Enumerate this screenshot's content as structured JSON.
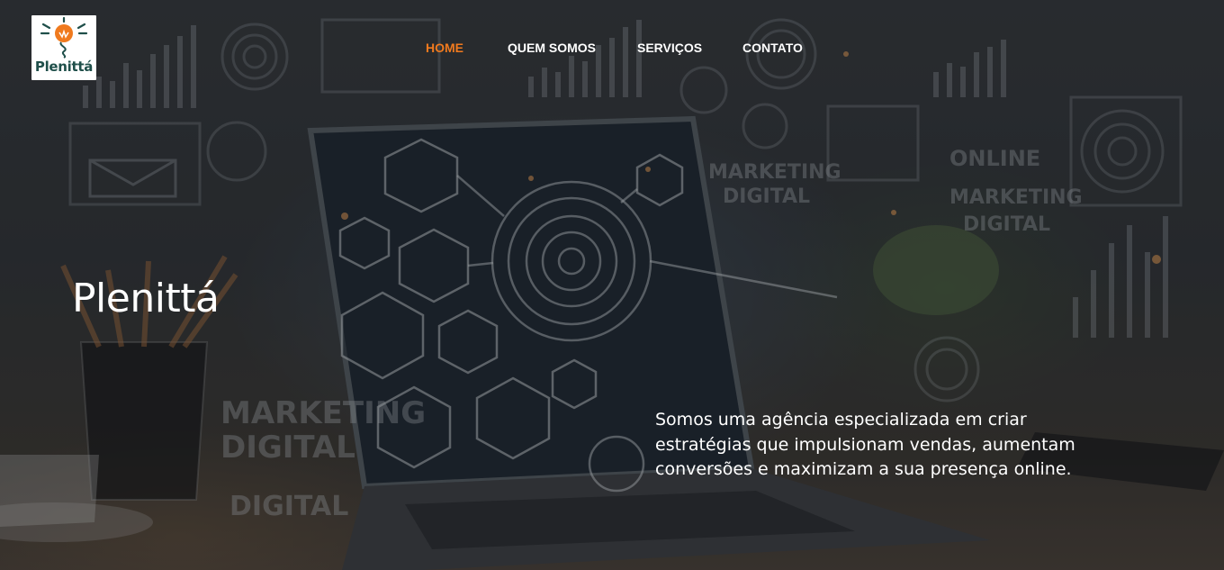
{
  "brand": {
    "logo_text": "Plenittá",
    "logo_icon": "lightbulb-icon",
    "colors": {
      "accent": "#f07a1e",
      "logo_text": "#1f4f4a",
      "text": "#ffffff"
    }
  },
  "nav": {
    "items": [
      {
        "label": "HOME",
        "active": true
      },
      {
        "label": "QUEM SOMOS",
        "active": false
      },
      {
        "label": "SERVIÇOS",
        "active": false
      },
      {
        "label": "CONTATO",
        "active": false
      }
    ]
  },
  "hero": {
    "title": "Plenittá",
    "description": "Somos uma agência especializada em criar estratégias que impulsionam vendas, aumentam conversões e maximizam a sua presença online.",
    "background_texts": [
      "MARKETING",
      "DIGITAL",
      "MARKETING",
      "DIGITAL",
      "DIGITAL",
      "MARKETING",
      "DIGITAL",
      "ONLINE"
    ]
  }
}
